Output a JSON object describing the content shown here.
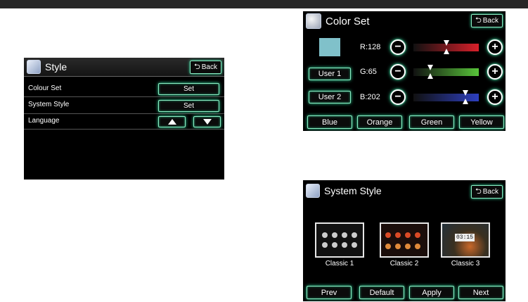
{
  "style_screen": {
    "title": "Style",
    "back_label": "Back",
    "items": [
      {
        "label": "Colour Set",
        "control": "Set"
      },
      {
        "label": "System Style",
        "control": "Set"
      },
      {
        "label": "Language"
      }
    ]
  },
  "color_screen": {
    "title": "Color Set",
    "back_label": "Back",
    "swatch_color": "#80c1ca",
    "user_buttons": [
      "User 1",
      "User 2"
    ],
    "channels": [
      {
        "label": "R:128",
        "value": 128,
        "max": 255,
        "color": "#d8202a"
      },
      {
        "label": "G:65",
        "value": 65,
        "max": 255,
        "color": "#58c43a"
      },
      {
        "label": "B:202",
        "value": 202,
        "max": 255,
        "color": "#2d3fbf"
      }
    ],
    "presets": [
      "Blue",
      "Orange",
      "Green",
      "Yellow"
    ]
  },
  "system_screen": {
    "title": "System Style",
    "back_label": "Back",
    "themes": [
      "Classic 1",
      "Classic 2",
      "Classic 3"
    ],
    "clock": "03:15",
    "buttons": [
      "Prev",
      "Default",
      "Apply",
      "Next"
    ]
  },
  "accent_glow": "#2fd49a"
}
